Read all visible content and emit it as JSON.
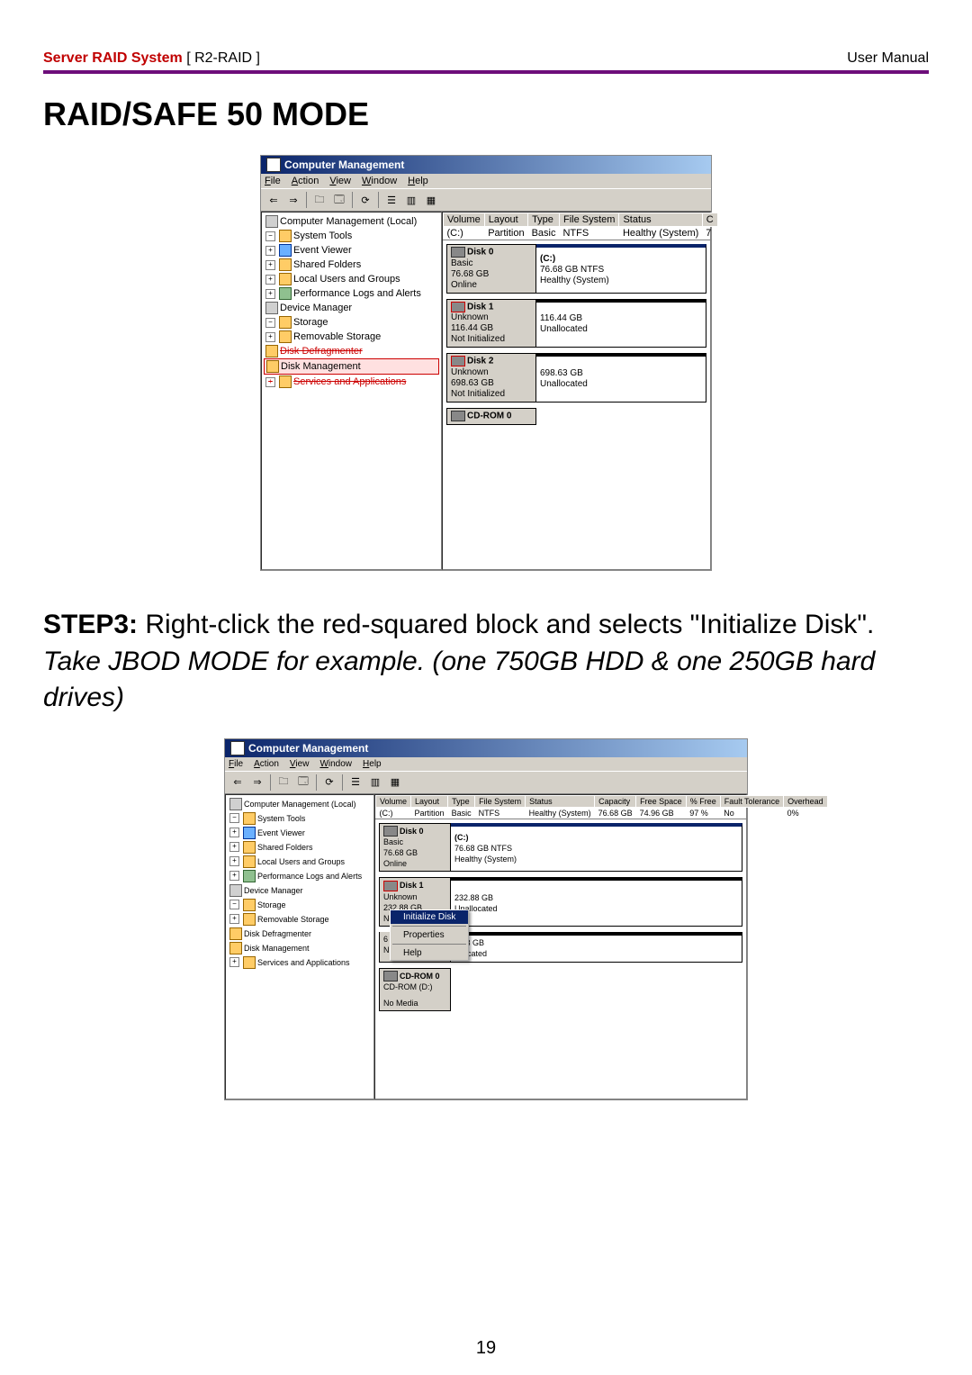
{
  "header": {
    "product": "Server RAID System",
    "model": "[ R2-RAID ]",
    "right": "User Manual"
  },
  "section_title": "RAID/SAFE 50 MODE",
  "step": {
    "label": "STEP3:",
    "text": "Right-click the red-squared block and selects \"Initialize Disk\".",
    "example": "Take JBOD MODE for example. (one 750GB HDD & one 250GB hard drives)"
  },
  "page_number": "19",
  "screenshot1": {
    "title": "Computer Management",
    "menu": {
      "file": "File",
      "action": "Action",
      "view": "View",
      "window": "Window",
      "help": "Help"
    },
    "tree": {
      "root": "Computer Management (Local)",
      "system_tools": "System Tools",
      "event_viewer": "Event Viewer",
      "shared_folders": "Shared Folders",
      "local_users": "Local Users and Groups",
      "perf_logs": "Performance Logs and Alerts",
      "device_manager": "Device Manager",
      "storage": "Storage",
      "removable": "Removable Storage",
      "defrag": "Disk Defragmenter",
      "diskmgmt": "Disk Management",
      "services": "Services and Applications"
    },
    "vol_headers": {
      "volume": "Volume",
      "layout": "Layout",
      "type": "Type",
      "fs": "File System",
      "status": "Status",
      "cap": "C"
    },
    "vol_row": {
      "volume": "(C:)",
      "layout": "Partition",
      "type": "Basic",
      "fs": "NTFS",
      "status": "Healthy (System)",
      "cap": "7"
    },
    "disk0": {
      "name": "Disk 0",
      "type": "Basic",
      "size": "76.68 GB",
      "state": "Online",
      "vol": "(C:)",
      "volinfo": "76.68 GB NTFS",
      "volstatus": "Healthy (System)"
    },
    "disk1": {
      "name": "Disk 1",
      "type": "Unknown",
      "size": "116.44 GB",
      "state": "Not Initialized",
      "vol": "",
      "volinfo": "116.44 GB",
      "volstatus": "Unallocated"
    },
    "disk2": {
      "name": "Disk 2",
      "type": "Unknown",
      "size": "698.63 GB",
      "state": "Not Initialized",
      "vol": "",
      "volinfo": "698.63 GB",
      "volstatus": "Unallocated"
    },
    "cdrom": {
      "name": "CD-ROM 0"
    }
  },
  "screenshot2": {
    "title": "Computer Management",
    "menu": {
      "file": "File",
      "action": "Action",
      "view": "View",
      "window": "Window",
      "help": "Help"
    },
    "tree": {
      "root": "Computer Management (Local)",
      "system_tools": "System Tools",
      "event_viewer": "Event Viewer",
      "shared_folders": "Shared Folders",
      "local_users": "Local Users and Groups",
      "perf_logs": "Performance Logs and Alerts",
      "device_manager": "Device Manager",
      "storage": "Storage",
      "removable": "Removable Storage",
      "defrag": "Disk Defragmenter",
      "diskmgmt": "Disk Management",
      "services": "Services and Applications"
    },
    "vol_headers": {
      "volume": "Volume",
      "layout": "Layout",
      "type": "Type",
      "fs": "File System",
      "status": "Status",
      "capacity": "Capacity",
      "free": "Free Space",
      "pfree": "% Free",
      "fault": "Fault Tolerance",
      "over": "Overhead"
    },
    "vol_row": {
      "volume": "(C:)",
      "layout": "Partition",
      "type": "Basic",
      "fs": "NTFS",
      "status": "Healthy (System)",
      "capacity": "76.68 GB",
      "free": "74.96 GB",
      "pfree": "97 %",
      "fault": "No",
      "over": "0%"
    },
    "disk0": {
      "name": "Disk 0",
      "type": "Basic",
      "size": "76.68 GB",
      "state": "Online",
      "vol": "(C:)",
      "volinfo": "76.68 GB NTFS",
      "volstatus": "Healthy (System)"
    },
    "disk1": {
      "name": "Disk 1",
      "type": "Unknown",
      "size": "232.88 GB",
      "state": "Not Initialized",
      "vol": "",
      "volinfo": "232.88 GB",
      "volstatus": "Unallocated"
    },
    "disk2_partial": {
      "size2": "8.63 GB",
      "status2": "allocated"
    },
    "cdrom": {
      "name": "CD-ROM 0",
      "sub": "CD-ROM (D:)",
      "media": "No Media"
    },
    "context": {
      "init": "Initialize Disk",
      "props": "Properties",
      "help": "Help"
    }
  }
}
